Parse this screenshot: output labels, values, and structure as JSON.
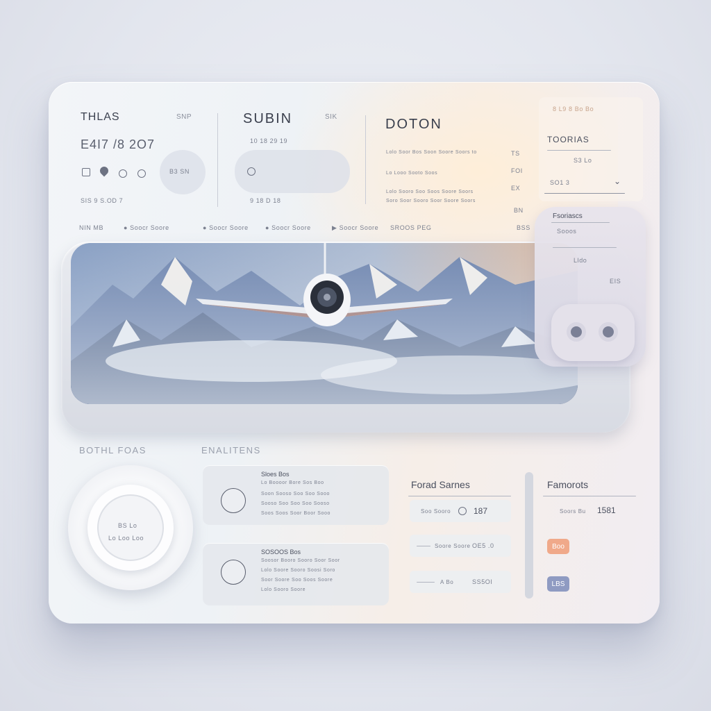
{
  "header": {
    "col1_title": "THLAS",
    "col1_meta": "SNP",
    "col1_value": "E4I7 /8 2O7",
    "col1_sub": "SIS  9  S.OD  7",
    "col1_bubble": "B3 SN",
    "col2_title": "SUBIN",
    "col2_meta": "SIK",
    "col2_ticks": "10    18    29    19",
    "col2_sub": "9     18    D    18",
    "col3_title": "DOTON",
    "col3_lines": [
      "Lolo Soor Bos Soon Soore Soors to",
      "Lo Looo Sooto Soos",
      "Lolo Sooro Soo Soos Soore Soors",
      "Soro Soor Sooro Soor Soore Soors"
    ],
    "col3_meta": [
      "TS",
      "FOI",
      "EX",
      "BN",
      "BSS"
    ]
  },
  "toolbar": {
    "items": [
      "NIN MB",
      "Soocr Soore",
      "Soocr Soore",
      "Soocr Soore",
      "Soocr Soore",
      "SROOS PEG"
    ]
  },
  "side_panel": {
    "top_meta": "8 L9 8 Bo Bo",
    "title": "TOORIAS",
    "field1": "S3 Lo",
    "field2": "SO1 3",
    "card_title": "Fsoriascs",
    "card_field": "Sooos",
    "card_label1": "Lldo",
    "card_label2": "EIS"
  },
  "bottom": {
    "left_title": "BOTHL FOAS",
    "dial_label": "BS Lo",
    "dial_sub": "Lo Loo Loo",
    "mid_title": "ENALITENS",
    "cards": [
      {
        "title": "Sloes Bos",
        "lines": [
          "Lo Boooor Bore Sos Boo",
          "Soon Sooso Soo Soo Sooo",
          "Sooso Soo Soo Soo Sooso",
          "Soos Soos Soor Boor Sooo"
        ]
      },
      {
        "title": "SOSOOS Bos",
        "lines": [
          "Soosor Booro Sooro Soor Soor",
          "Lolo Soore Sooro Soosi Soro",
          "Soor Soore Soo Soos Soore",
          "Lolo Sooro Soore"
        ]
      }
    ],
    "forecast": {
      "title": "Forad Sarnes",
      "rows": [
        "Soo Sooro",
        "Soore Soore",
        "A Bo"
      ],
      "values": [
        "187",
        "OE5 .0",
        "SS5OI"
      ]
    },
    "famorts": {
      "title": "Famorots",
      "row": "Soors Bu",
      "value": "1581",
      "tag1": "Boo",
      "tag2": "LBS"
    }
  },
  "colors": {
    "accent_orange": "#f0a98a",
    "accent_blue": "#8f9bc2"
  }
}
